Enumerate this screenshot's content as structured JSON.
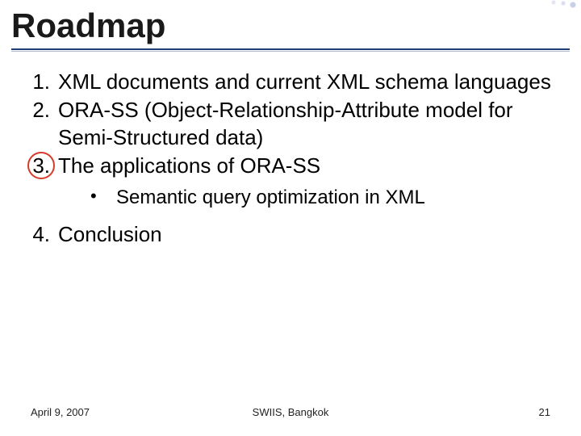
{
  "title": "Roadmap",
  "items": [
    {
      "num": "1.",
      "text": "XML documents and current XML schema languages",
      "circled": false
    },
    {
      "num": "2.",
      "text": "ORA-SS (Object-Relationship-Attribute model for Semi-Structured data)",
      "circled": false
    },
    {
      "num": "3.",
      "text": "The applications of ORA-SS",
      "circled": true,
      "sub": {
        "bullet": "•",
        "text": "Semantic query optimization in XML"
      }
    },
    {
      "num": "4.",
      "text": "Conclusion",
      "circled": false
    }
  ],
  "footer": {
    "left": "April 9, 2007",
    "center": "SWIIS, Bangkok",
    "right": "21"
  }
}
